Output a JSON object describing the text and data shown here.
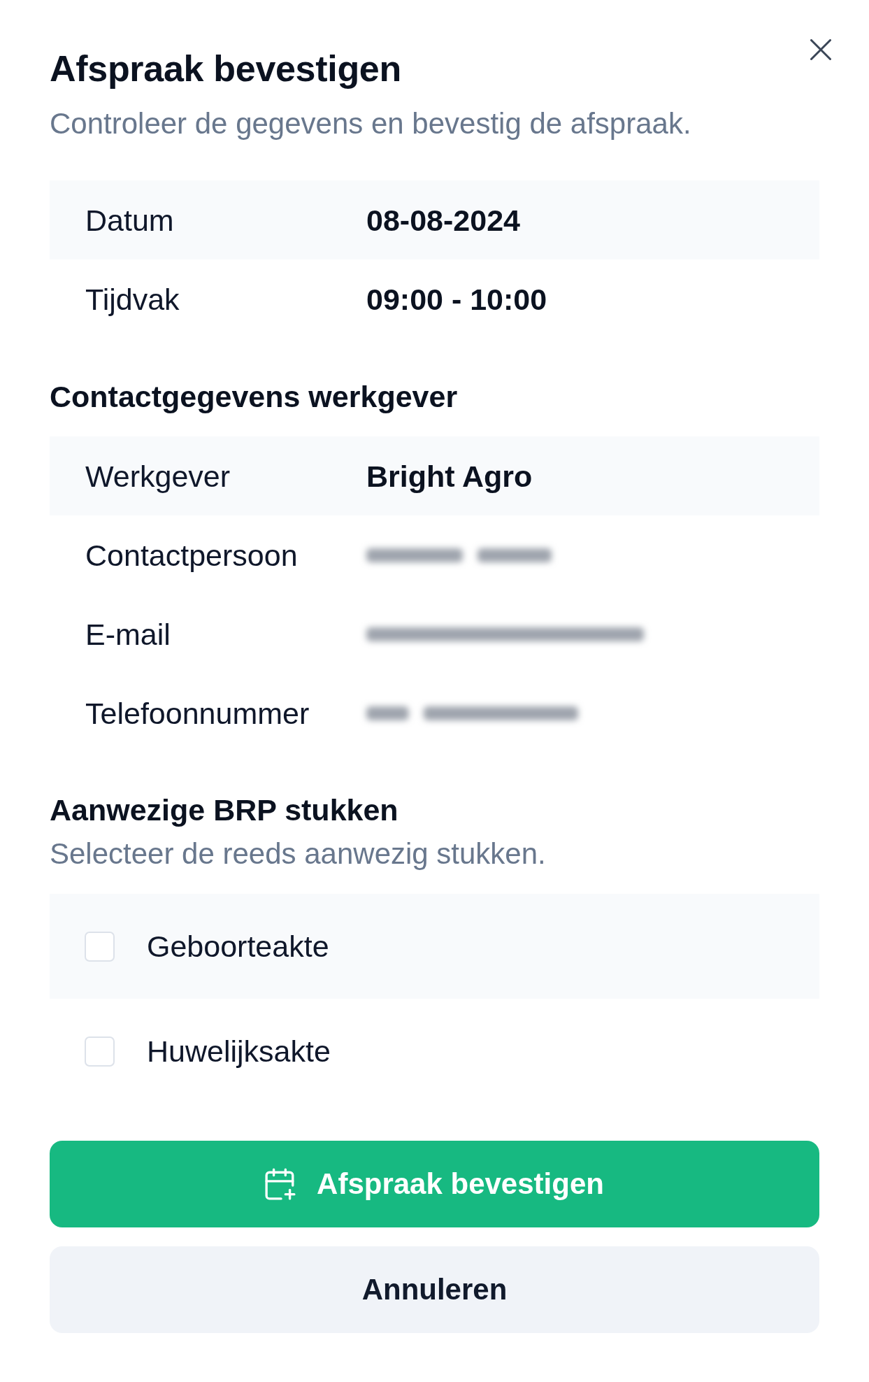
{
  "dialog": {
    "title": "Afspraak bevestigen",
    "subtitle": "Controleer de gegevens en bevestig de afspraak."
  },
  "appointment": {
    "rows": [
      {
        "label": "Datum",
        "value": "08-08-2024"
      },
      {
        "label": "Tijdvak",
        "value": "09:00 - 10:00"
      }
    ]
  },
  "employer_contact": {
    "heading": "Contactgegevens werkgever",
    "rows": [
      {
        "label": "Werkgever",
        "value": "Bright Agro",
        "redacted": false
      },
      {
        "label": "Contactpersoon",
        "redacted": true
      },
      {
        "label": "E-mail",
        "redacted": true
      },
      {
        "label": "Telefoonnummer",
        "redacted": true
      }
    ]
  },
  "documents": {
    "heading": "Aanwezige BRP stukken",
    "subtitle": "Selecteer de reeds aanwezig stukken.",
    "items": [
      {
        "label": "Geboorteakte",
        "checked": false
      },
      {
        "label": "Huwelijksakte",
        "checked": false
      }
    ]
  },
  "buttons": [
    {
      "kind": "primary",
      "label": "Afspraak bevestigen"
    },
    {
      "kind": "secondary",
      "label": "Annuleren"
    }
  ]
}
